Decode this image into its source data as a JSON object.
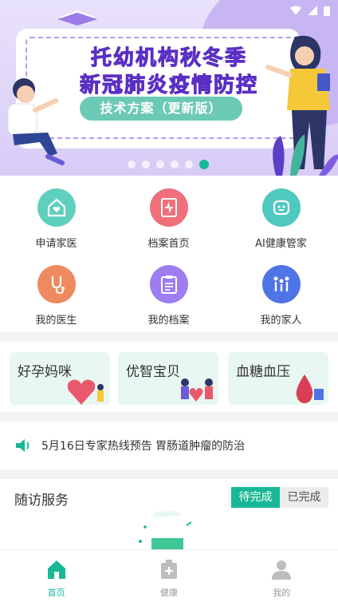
{
  "banner": {
    "title_line1": "托幼机构秋冬季",
    "title_line2": "新冠肺炎疫情防控",
    "pill_text": "技术方案（更新版）",
    "dots": 6,
    "active_dot": 5
  },
  "grid": {
    "items": [
      {
        "label": "申请家医",
        "icon": "home-heart-icon",
        "color": "#5fd0bd"
      },
      {
        "label": "档案首页",
        "icon": "document-heart-icon",
        "color": "#ef6f7b"
      },
      {
        "label": "AI健康管家",
        "icon": "robot-icon",
        "color": "#4fc8c0"
      },
      {
        "label": "我的医生",
        "icon": "stethoscope-icon",
        "color": "#ef8a5e"
      },
      {
        "label": "我的档案",
        "icon": "clipboard-icon",
        "color": "#9d7df0"
      },
      {
        "label": "我的家人",
        "icon": "family-icon",
        "color": "#4f74e6"
      }
    ]
  },
  "cards": [
    {
      "label": "好孕妈咪"
    },
    {
      "label": "优智宝贝"
    },
    {
      "label": "血糖血压"
    }
  ],
  "notice": {
    "text": "5月16日专家热线预告 胃肠道肿瘤的防治",
    "icon": "speaker-icon"
  },
  "followup": {
    "title": "随访服务",
    "tab_pending": "待完成",
    "tab_done": "已完成"
  },
  "nav": {
    "home": "首页",
    "health": "健康",
    "mine": "我的"
  },
  "colors": {
    "accent": "#18b896",
    "inactive": "#bdbdbd"
  }
}
